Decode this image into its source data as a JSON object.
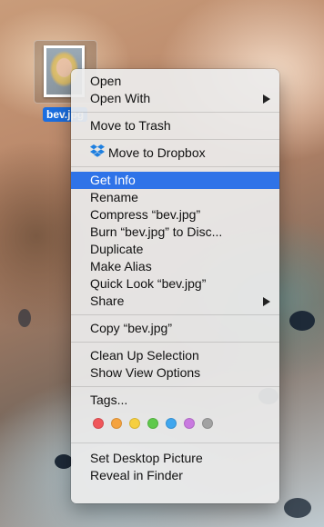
{
  "desktop": {
    "file_label": "bev.jpg"
  },
  "context_menu": {
    "open": "Open",
    "open_with": "Open With",
    "move_to_trash": "Move to Trash",
    "move_to_dropbox": "Move to Dropbox",
    "get_info": "Get Info",
    "rename": "Rename",
    "compress": "Compress “bev.jpg”",
    "burn": "Burn “bev.jpg” to Disc...",
    "duplicate": "Duplicate",
    "make_alias": "Make Alias",
    "quick_look": "Quick Look “bev.jpg”",
    "share": "Share",
    "copy": "Copy “bev.jpg”",
    "clean_up": "Clean Up Selection",
    "show_view_options": "Show View Options",
    "tags": "Tags...",
    "tag_colors": [
      "#f0565a",
      "#f5a33f",
      "#f6cf3e",
      "#5fc94b",
      "#3fa6ee",
      "#c97ae0",
      "#a2a2a2"
    ],
    "set_desktop_picture": "Set Desktop Picture",
    "reveal_in_finder": "Reveal in Finder",
    "highlight_color": "#2f73e8"
  }
}
